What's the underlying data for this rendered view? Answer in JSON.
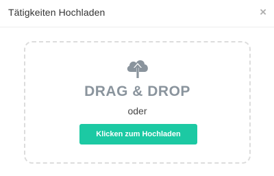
{
  "modal": {
    "title": "Tätigkeiten Hochladen",
    "close_glyph": "×"
  },
  "dropzone": {
    "icon": "cloud-upload-icon",
    "title": "DRAG & DROP",
    "or_text": "oder",
    "button_label": "Klicken zum Hochladen"
  },
  "colors": {
    "accent": "#1cc9a3",
    "icon": "#8a949d",
    "border": "#dcdcdc"
  }
}
